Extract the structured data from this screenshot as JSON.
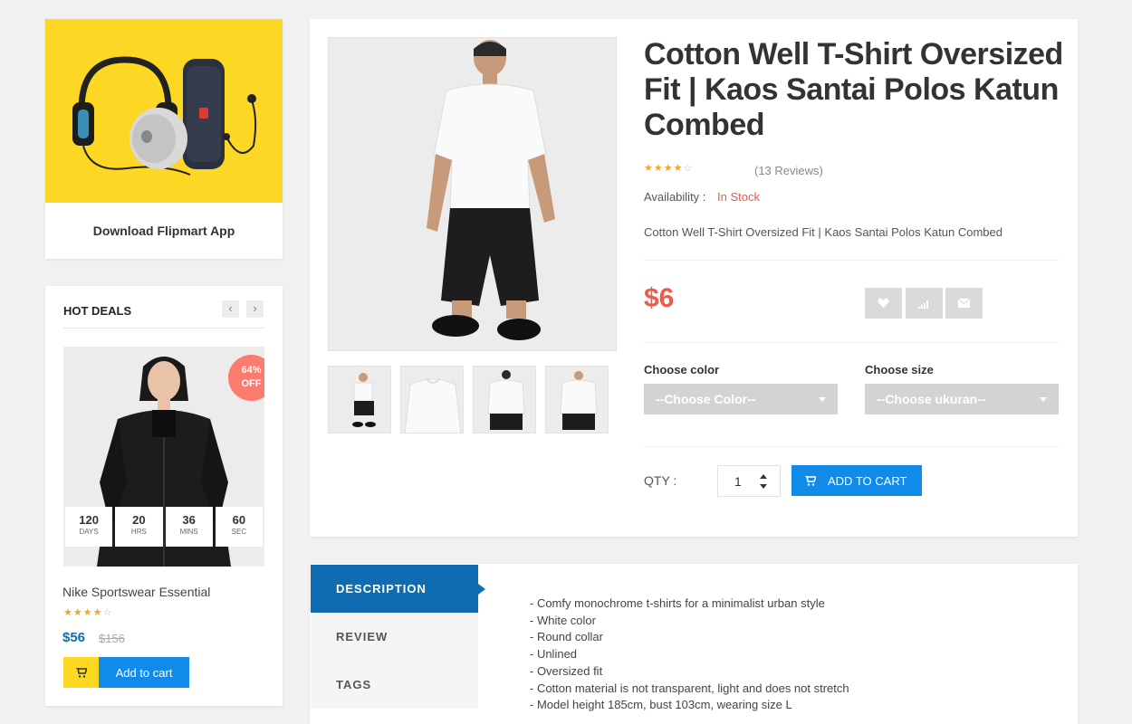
{
  "promo": {
    "caption": "Download Flipmart App"
  },
  "hot_deals": {
    "title": "HOT DEALS",
    "prev": "‹",
    "next": "›",
    "badge_percent": "64%",
    "badge_off": "OFF",
    "countdown": [
      {
        "num": "120",
        "label": "DAYS"
      },
      {
        "num": "20",
        "label": "HRS"
      },
      {
        "num": "36",
        "label": "MINS"
      },
      {
        "num": "60",
        "label": "SEC"
      }
    ],
    "product_name": "Nike Sportswear Essential",
    "rating": 4,
    "price": "$56",
    "old_price": "$156",
    "add_to_cart": "Add to cart"
  },
  "product": {
    "title": "Cotton Well T-Shirt Oversized Fit | Kaos Santai Polos Katun Combed",
    "rating": 4,
    "reviews": "(13 Reviews)",
    "availability_label": "Availability :",
    "availability_value": "In Stock",
    "short_desc": "Cotton Well T-Shirt Oversized Fit | Kaos Santai Polos Katun Combed",
    "price": "$6",
    "color_label": "Choose color",
    "color_select": "--Choose Color--",
    "size_label": "Choose size",
    "size_select": "--Choose ukuran--",
    "qty_label": "QTY :",
    "qty_value": "1",
    "add_to_cart": "ADD TO CART"
  },
  "tabs": {
    "description": "DESCRIPTION",
    "review": "REVIEW",
    "tags": "TAGS",
    "description_lines": [
      "- Comfy monochrome t-shirts for a minimalist urban style",
      "- White color",
      "- Round collar",
      "- Unlined",
      "- Oversized fit",
      "- Cotton material is not transparent, light and does not stretch",
      "- Model height 185cm, bust 103cm, wearing size L"
    ]
  },
  "colors": {
    "accent_blue": "#0f6cb2",
    "button_blue": "#108bea",
    "price_red": "#ef5a4a",
    "star": "#f5a623",
    "banner_yellow": "#fcd724",
    "cart_yellow": "#fdd922"
  }
}
